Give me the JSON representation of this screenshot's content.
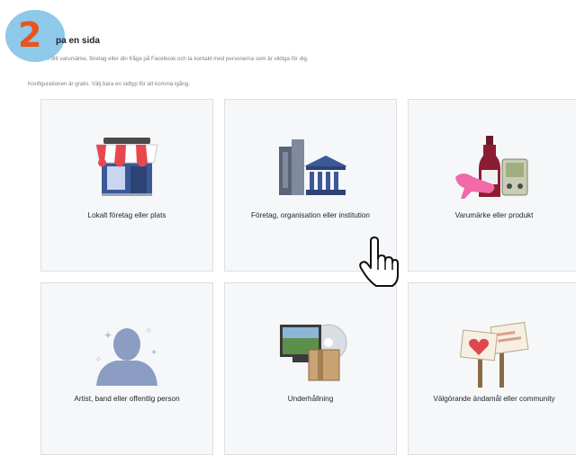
{
  "step_badge": "2",
  "header": {
    "title": "pa en sida",
    "intro": "Lyft fram ditt varumärke, företag eller din fråga på Facebook och ta kontakt med personerna som är viktiga för dig.",
    "config_note": "Konfigurationen är gratis. Välj bara en sidtyp för att komma igång."
  },
  "categories": [
    {
      "label": "Lokalt företag eller plats",
      "icon": "storefront-icon"
    },
    {
      "label": "Företag, organisation eller institution",
      "icon": "building-icon"
    },
    {
      "label": "Varumärke eller produkt",
      "icon": "products-icon"
    },
    {
      "label": "Artist, band eller offentlig person",
      "icon": "person-icon"
    },
    {
      "label": "Underhållning",
      "icon": "entertainment-icon"
    },
    {
      "label": "Välgörande ändamål eller community",
      "icon": "signs-icon"
    }
  ],
  "colors": {
    "badge_bg": "#8ec9ea",
    "badge_text": "#e8541c",
    "card_bg": "#f6f7f9"
  }
}
